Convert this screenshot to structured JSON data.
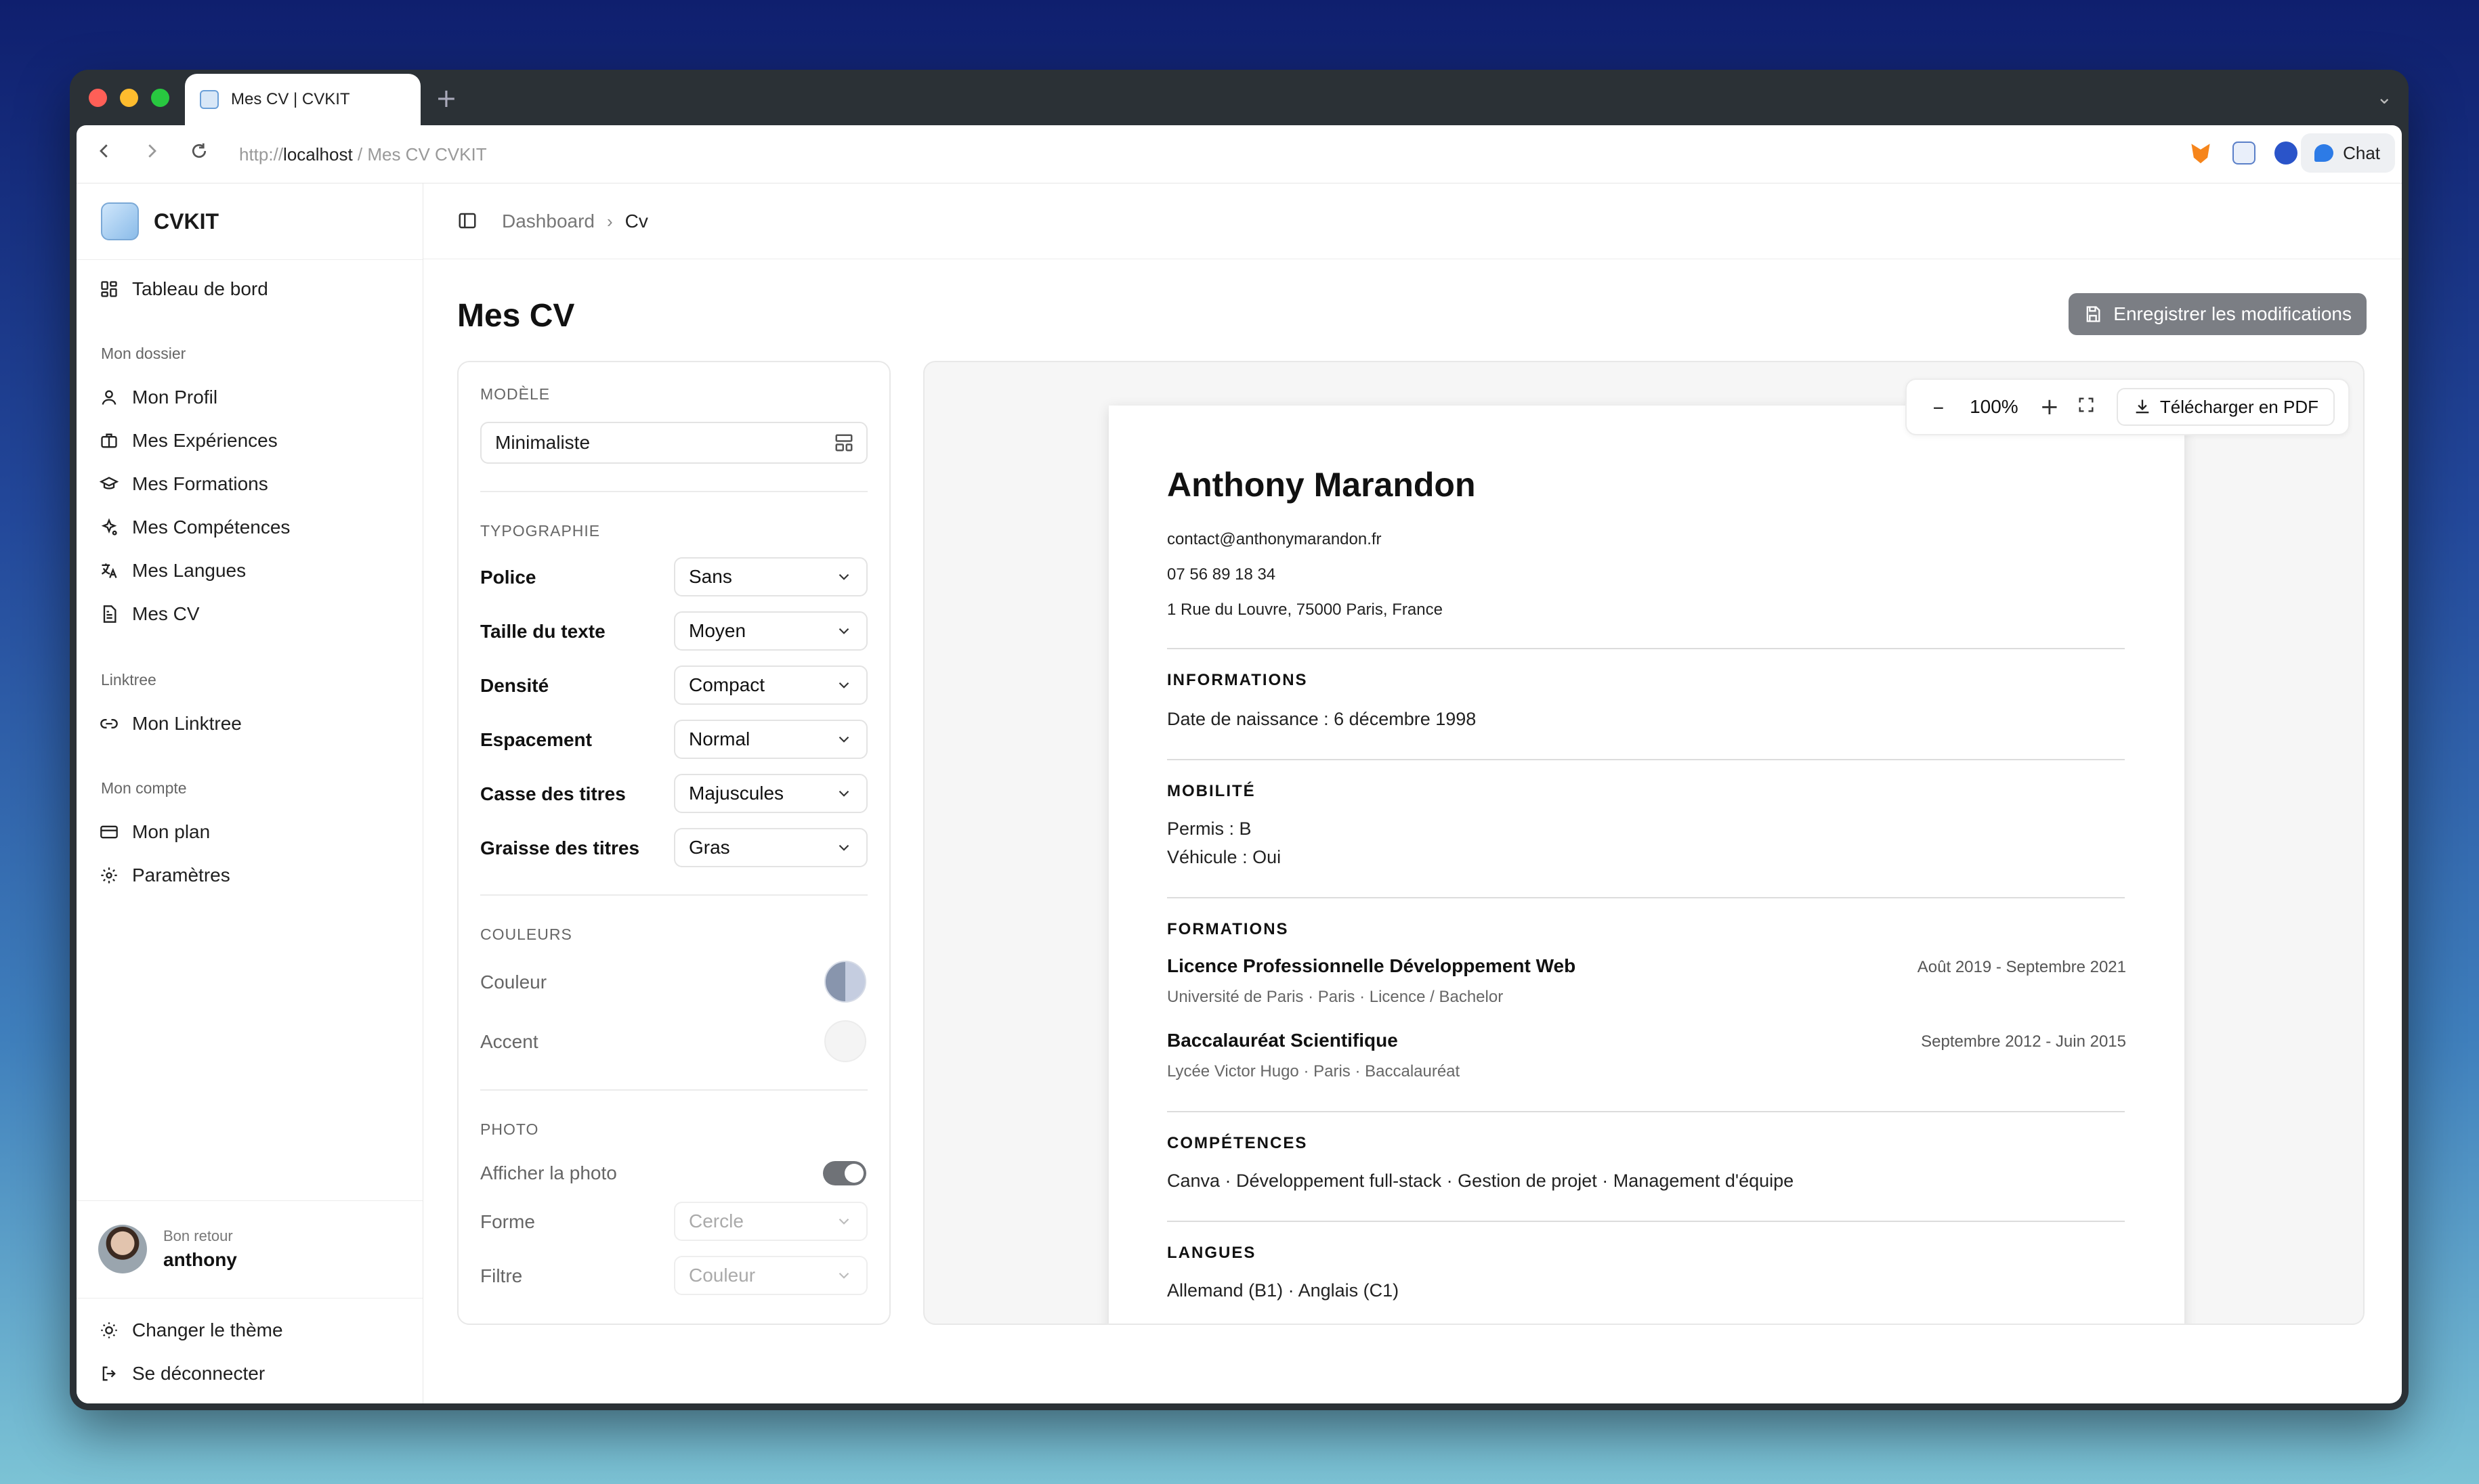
{
  "browser": {
    "tab_title": "Mes CV | CVKIT",
    "new_tab": "+",
    "url_scheme": "http://",
    "url_host": "localhost",
    "url_rest": " / Mes CV CVKIT",
    "chat_label": "Chat"
  },
  "sidebar": {
    "brand": "CVKIT",
    "dashboard": "Tableau de bord",
    "group_dossier": "Mon dossier",
    "dossier_items": [
      "Mon Profil",
      "Mes Expériences",
      "Mes Formations",
      "Mes Compétences",
      "Mes Langues",
      "Mes CV"
    ],
    "group_linktree": "Linktree",
    "linktree_item": "Mon Linktree",
    "group_compte": "Mon compte",
    "compte_items": [
      "Mon plan",
      "Paramètres"
    ],
    "user_greeting": "Bon retour",
    "user_name": "anthony",
    "theme": "Changer le thème",
    "logout": "Se déconnecter"
  },
  "header": {
    "breadcrumb_root": "Dashboard",
    "breadcrumb_current": "Cv",
    "page_title": "Mes CV",
    "save_label": "Enregistrer les modifications"
  },
  "settings": {
    "section_model": "MODÈLE",
    "model_value": "Minimaliste",
    "section_typo": "TYPOGRAPHIE",
    "typo_rows": [
      {
        "label": "Police",
        "value": "Sans"
      },
      {
        "label": "Taille du texte",
        "value": "Moyen"
      },
      {
        "label": "Densité",
        "value": "Compact"
      },
      {
        "label": "Espacement",
        "value": "Normal"
      },
      {
        "label": "Casse des titres",
        "value": "Majuscules"
      },
      {
        "label": "Graisse des titres",
        "value": "Gras"
      }
    ],
    "section_colors": "COULEURS",
    "color_label": "Couleur",
    "accent_label": "Accent",
    "section_photo": "PHOTO",
    "show_photo_label": "Afficher la photo",
    "show_photo_on": true,
    "shape_label": "Forme",
    "shape_value": "Cercle",
    "filter_label": "Filtre",
    "filter_value": "Couleur",
    "colors": {
      "primary": "#7c8aa6",
      "accent": "#f3f3f3"
    }
  },
  "preview": {
    "zoom": "100%",
    "zoom_out": "–",
    "zoom_in": "+",
    "pdf_label": "Télécharger en PDF",
    "cv": {
      "name": "Anthony Marandon",
      "email": "contact@anthonymarandon.fr",
      "phone": "07 56 89 18 34",
      "address": "1 Rue du Louvre, 75000 Paris, France",
      "sec_info": "INFORMATIONS",
      "birth": "Date de naissance : 6 décembre 1998",
      "sec_mobility": "MOBILITÉ",
      "permit": "Permis : B",
      "vehicle": "Véhicule : Oui",
      "sec_education": "FORMATIONS",
      "edu": [
        {
          "title": "Licence Professionnelle Développement Web",
          "sub": "Université de Paris · Paris · Licence / Bachelor",
          "date": "Août 2019 - Septembre 2021"
        },
        {
          "title": "Baccalauréat Scientifique",
          "sub": "Lycée Victor Hugo · Paris · Baccalauréat",
          "date": "Septembre 2012 - Juin 2015"
        }
      ],
      "sec_skills": "COMPÉTENCES",
      "skills": "Canva · Développement full-stack · Gestion de projet · Management d'équipe",
      "sec_languages": "LANGUES",
      "languages": "Allemand (B1) · Anglais (C1)"
    }
  }
}
